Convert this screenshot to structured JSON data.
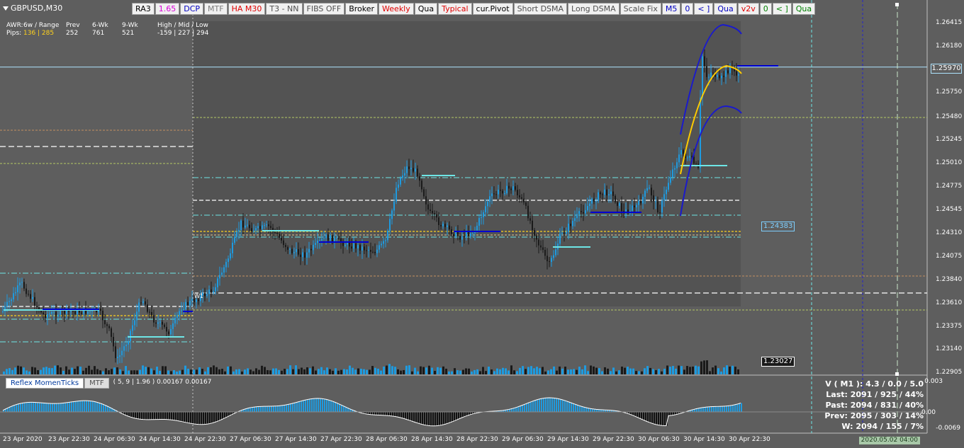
{
  "symbol": "GBPUSD,M30",
  "toolbar": [
    {
      "label": "RA3",
      "color": "#000000"
    },
    {
      "label": "1.65",
      "color": "#d800d8"
    },
    {
      "label": "DCP",
      "color": "#0000c0"
    },
    {
      "label": "MTF",
      "color": "#7c7c7c"
    },
    {
      "label": "HA M30",
      "color": "#e00000"
    },
    {
      "label": "T3 - NN",
      "color": "#505050"
    },
    {
      "label": "FIBS OFF",
      "color": "#505050"
    },
    {
      "label": "Broker",
      "color": "#000000"
    },
    {
      "label": "Weekly",
      "color": "#e00000"
    },
    {
      "label": "Qua",
      "color": "#000000"
    },
    {
      "label": "Typical",
      "color": "#e00000"
    },
    {
      "label": "cur.Pivot",
      "color": "#000000"
    },
    {
      "label": "Short DSMA",
      "color": "#505050"
    },
    {
      "label": "Long DSMA",
      "color": "#505050"
    },
    {
      "label": "Scale Fix",
      "color": "#505050"
    },
    {
      "label": "M5",
      "color": "#0000c0"
    },
    {
      "label": "0",
      "color": "#0000c0"
    },
    {
      "label": "< ]",
      "color": "#0000c0"
    },
    {
      "label": "Qua",
      "color": "#0000c0"
    },
    {
      "label": "v2v",
      "color": "#e00000"
    },
    {
      "label": "0",
      "color": "#008000"
    },
    {
      "label": "< ]",
      "color": "#008000"
    },
    {
      "label": "Qua",
      "color": "#008000"
    }
  ],
  "awr": {
    "row1": [
      "AWR:",
      "6w / Range",
      "Prev",
      "6-Wk",
      "9-Wk",
      "High / Mid / Low"
    ],
    "row2_label": "Pips:",
    "row2_range": "136 | 285",
    "row2_prev": "252",
    "row2_6wk": "761",
    "row2_9wk": "521",
    "row2_hml": "-159  |  227  |  294"
  },
  "price_axis": [
    "1.26415",
    "1.26180",
    "1.25750",
    "1.25480",
    "1.25245",
    "1.25010",
    "1.24775",
    "1.24545",
    "1.24310",
    "1.24075",
    "1.23840",
    "1.23610",
    "1.23375",
    "1.23140",
    "1.22905"
  ],
  "current_price": "1.25970",
  "level_boxes": [
    {
      "label": "1.24383",
      "style": "light"
    },
    {
      "label": "1.23027",
      "style": "dark"
    }
  ],
  "w1_label": "W1",
  "time_axis": [
    "23 Apr 2020",
    "23 Apr 22:30",
    "24 Apr 06:30",
    "24 Apr 14:30",
    "24 Apr 22:30",
    "27 Apr 06:30",
    "27 Apr 14:30",
    "27 Apr 22:30",
    "28 Apr 06:30",
    "28 Apr 14:30",
    "28 Apr 22:30",
    "29 Apr 06:30",
    "29 Apr 14:30",
    "29 Apr 22:30",
    "30 Apr 06:30",
    "30 Apr 14:30",
    "30 Apr 22:30"
  ],
  "indicator": {
    "name": "Reflex MomenTicks",
    "mtf": "MTF",
    "params": "( 5, 9 | 1.96 ) 0.00167 0.00167",
    "axis": [
      "0.003",
      "0.00",
      "-0.0069"
    ]
  },
  "volume_stats": [
    "V ( M1 ): 4.3 / 0.0 / 5.0",
    "Last: 2091 / 925 / 44%",
    "Past: 2094 / 831 / 40%",
    "Prev: 2095 / 303 / 14%",
    "W: 2094 / 155 / 7%"
  ],
  "date_badge": "2020.05.02 04:00",
  "colors": {
    "bull": "#1e9be0",
    "bear": "#1a1a1a",
    "cyan": "#6ee6e6",
    "pivot": "#0000d0",
    "yellow": "#ffd21e"
  }
}
